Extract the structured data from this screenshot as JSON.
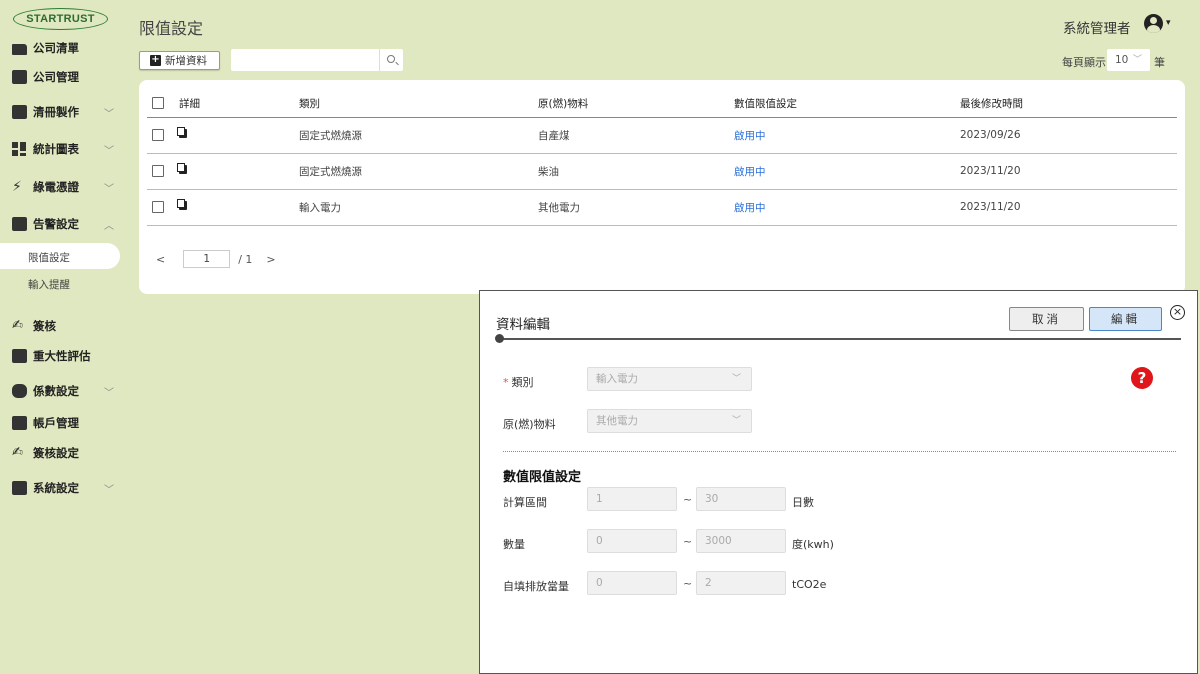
{
  "sidebar": {
    "logo": "STARTRUST",
    "items": [
      {
        "label": "公司清單",
        "icon": "folder-icon",
        "chevron": ""
      },
      {
        "label": "公司管理",
        "icon": "company-icon",
        "chevron": ""
      },
      {
        "label": "清冊製作",
        "icon": "inventory-icon",
        "chevron": "﹀"
      },
      {
        "label": "統計圖表",
        "icon": "dashboard-icon",
        "chevron": "﹀"
      },
      {
        "label": "綠電憑證",
        "icon": "bolt-icon",
        "chevron": "﹀"
      },
      {
        "label": "告警設定",
        "icon": "alert-icon",
        "chevron": "︿"
      },
      {
        "label": "簽核",
        "icon": "sign-icon",
        "chevron": ""
      },
      {
        "label": "重大性評估",
        "icon": "clipboard-check-icon",
        "chevron": ""
      },
      {
        "label": "係數設定",
        "icon": "database-icon",
        "chevron": "﹀"
      },
      {
        "label": "帳戶管理",
        "icon": "account-icon",
        "chevron": ""
      },
      {
        "label": "簽核設定",
        "icon": "sign-settings-icon",
        "chevron": ""
      },
      {
        "label": "系統設定",
        "icon": "wrench-icon",
        "chevron": "﹀"
      }
    ],
    "sub_items": [
      {
        "label": "限值設定",
        "active": true
      },
      {
        "label": "輸入提醒",
        "active": false
      }
    ]
  },
  "header": {
    "title": "限值設定",
    "user_name": "系統管理者",
    "user_caret": "▾"
  },
  "toolbar": {
    "add_label": "新增資料",
    "search_placeholder": "",
    "per_page_label": "每頁顯示",
    "per_page_value": "10",
    "per_page_unit": "筆"
  },
  "table": {
    "columns": [
      "詳細",
      "類別",
      "原(燃)物料",
      "數值限值設定",
      "最後修改時間"
    ],
    "rows": [
      {
        "category": "固定式燃燒源",
        "material": "自產煤",
        "status": "啟用中",
        "modified": "2023/09/26"
      },
      {
        "category": "固定式燃燒源",
        "material": "柴油",
        "status": "啟用中",
        "modified": "2023/11/20"
      },
      {
        "category": "輸入電力",
        "material": "其他電力",
        "status": "啟用中",
        "modified": "2023/11/20"
      }
    ]
  },
  "pager": {
    "prev": "<",
    "current": "1",
    "total": "/ 1",
    "next": ">"
  },
  "modal": {
    "title": "資料編輯",
    "cancel_label": "取消",
    "edit_label": "編輯",
    "close_symbol": "×",
    "help_symbol": "?",
    "fields": {
      "category_label": "類別",
      "category_value": "輸入電力",
      "material_label": "原(燃)物料",
      "material_value": "其他電力"
    },
    "section_title": "數值限值設定",
    "ranges": [
      {
        "label": "計算區間",
        "min": "1",
        "max": "30",
        "unit": "日數"
      },
      {
        "label": "數量",
        "min": "0",
        "max": "3000",
        "unit": "度(kwh)"
      },
      {
        "label": "自填排放當量",
        "min": "0",
        "max": "2",
        "unit": "tCO2e"
      }
    ]
  }
}
